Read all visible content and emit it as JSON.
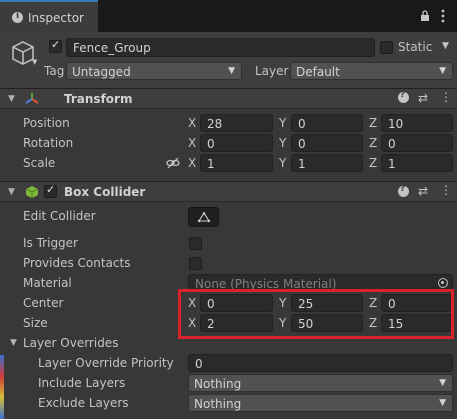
{
  "tab": {
    "title": "Inspector",
    "icon": "info-icon"
  },
  "window_icons": [
    "lock-icon",
    "kebab-menu-icon"
  ],
  "object": {
    "name": "Fence_Group",
    "active": true,
    "static_label": "Static",
    "tag_label": "Tag",
    "tag_value": "Untagged",
    "layer_label": "Layer",
    "layer_value": "Default"
  },
  "transform": {
    "title": "Transform",
    "rows": [
      {
        "label": "Position",
        "x": "28",
        "y": "0",
        "z": "10"
      },
      {
        "label": "Rotation",
        "x": "0",
        "y": "0",
        "z": "0"
      },
      {
        "label": "Scale",
        "x": "1",
        "y": "1",
        "z": "1"
      }
    ]
  },
  "box_collider": {
    "title": "Box Collider",
    "enabled": true,
    "edit_collider_label": "Edit Collider",
    "is_trigger_label": "Is Trigger",
    "provides_contacts_label": "Provides Contacts",
    "material_label": "Material",
    "material_value": "None (Physics Material)",
    "center": {
      "label": "Center",
      "x": "0",
      "y": "25",
      "z": "0"
    },
    "size": {
      "label": "Size",
      "x": "2",
      "y": "50",
      "z": "15"
    },
    "layer_overrides": {
      "label": "Layer Overrides",
      "priority_label": "Layer Override Priority",
      "priority_value": "0",
      "include_label": "Include Layers",
      "include_value": "Nothing",
      "exclude_label": "Exclude Layers",
      "exclude_value": "Nothing"
    }
  },
  "axes": {
    "x": "X",
    "y": "Y",
    "z": "Z"
  },
  "colors": {
    "highlight": "#d9232b",
    "accent": "#3a79bb"
  }
}
